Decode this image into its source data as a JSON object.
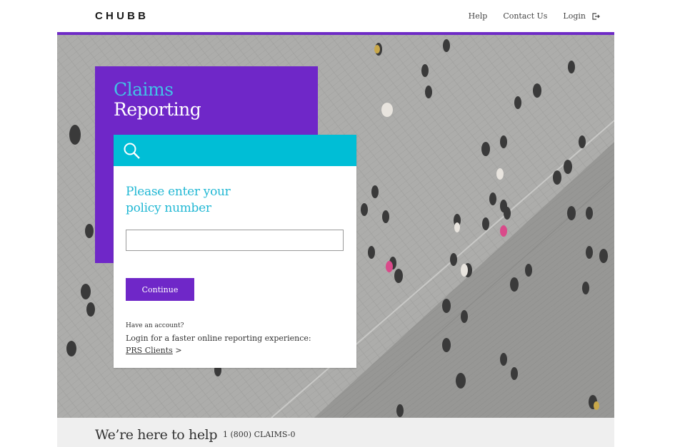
{
  "header": {
    "logo": "CHUBB",
    "nav": {
      "help": "Help",
      "contact": "Contact Us",
      "login": "Login"
    }
  },
  "hero": {
    "title_line1": "Claims",
    "title_line2": "Reporting"
  },
  "form": {
    "prompt_line1": "Please enter your",
    "prompt_line2": "policy number",
    "policy_value": "",
    "continue_label": "Continue",
    "account_question": "Have an account?",
    "account_text": "Login for a faster online reporting experience:",
    "prs_link": "PRS Clients",
    "prs_arrow": ">"
  },
  "help": {
    "title": "We’re here to help",
    "phone": "1 (800) CLAIMS-0"
  },
  "colors": {
    "purple": "#6f27c8",
    "cyan": "#00bed6",
    "light_blue_text": "#42c3e6"
  },
  "icons": {
    "search": "search-icon",
    "logout": "logout-icon"
  }
}
